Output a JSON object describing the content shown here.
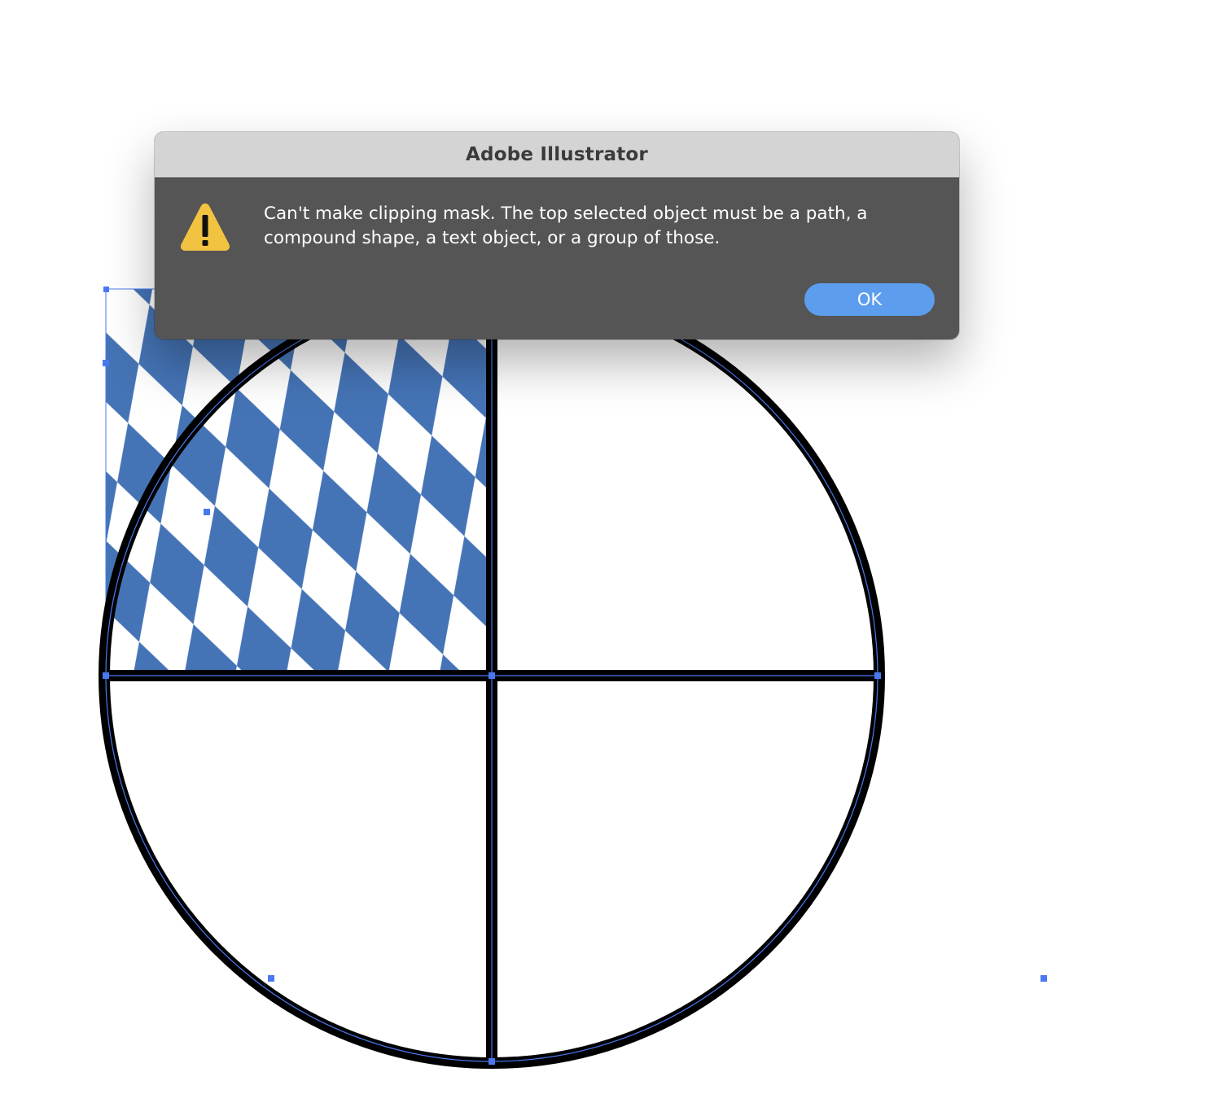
{
  "dialog": {
    "title": "Adobe Illustrator",
    "message": "Can't make clipping mask. The top selected object must be a path, a compound shape, a text object, or a group of those.",
    "icon": "warning-icon",
    "ok_label": "OK"
  },
  "artwork": {
    "pattern_color": "#4574b6",
    "stroke_color": "#000000",
    "selection_color": "#4a78f0",
    "dialog_button_color": "#5c9ded",
    "warning_icon_color": "#f2c340"
  }
}
